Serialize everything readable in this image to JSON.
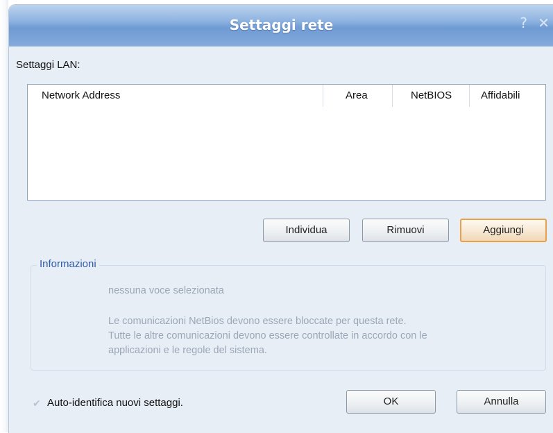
{
  "window": {
    "title": "Settaggi rete",
    "help_glyph": "?",
    "close_glyph": "✕"
  },
  "lan": {
    "label": "Settaggi LAN:",
    "columns": [
      "Network Address",
      "Area",
      "NetBIOS",
      "Affidabili"
    ],
    "rows": []
  },
  "buttons": {
    "individua": "Individua",
    "rimuovi": "Rimuovi",
    "aggiungi": "Aggiungi",
    "ok": "OK",
    "annulla": "Annulla"
  },
  "info": {
    "title": "Informazioni",
    "selection": "nessuna voce selezionata",
    "line1": "Le comunicazioni NetBios devono essere bloccate per questa rete.",
    "line2": "Tutte le altre comunicazioni devono essere controllate in accordo con le",
    "line3": "applicazioni e le regole del sistema."
  },
  "auto_identify": {
    "label": "Auto-identifica nuovi settaggi.",
    "check_glyph": "✔",
    "checked": true
  },
  "colors": {
    "title_text": "#ffffff",
    "info_title": "#2f5aa8",
    "info_text": "#9aa7b6",
    "default_button_border": "#e8a14a"
  }
}
